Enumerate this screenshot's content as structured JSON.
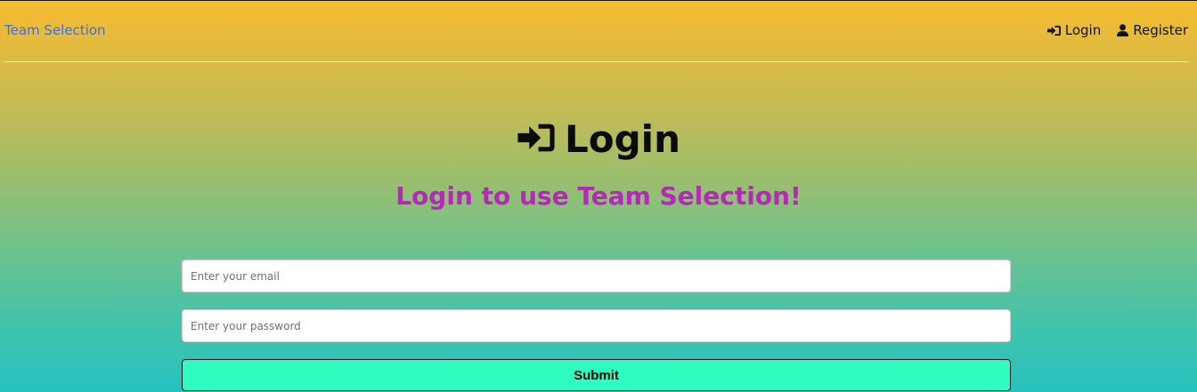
{
  "navbar": {
    "brand": "Team Selection",
    "links": [
      {
        "label": "Login",
        "icon": "sign-in-icon"
      },
      {
        "label": "Register",
        "icon": "user-icon"
      }
    ]
  },
  "main": {
    "title": "Login",
    "title_icon": "sign-in-icon",
    "subtitle": "Login to use Team Selection!",
    "form": {
      "email_placeholder": "Enter your email",
      "password_placeholder": "Enter your password",
      "submit_label": "Submit"
    }
  },
  "colors": {
    "brand_link": "#3a6fe6",
    "subtitle": "#b528b8",
    "submit_bg": "#2ffdbf",
    "gradient_top": "#f8bb2f",
    "gradient_bottom": "#26c2bf"
  }
}
